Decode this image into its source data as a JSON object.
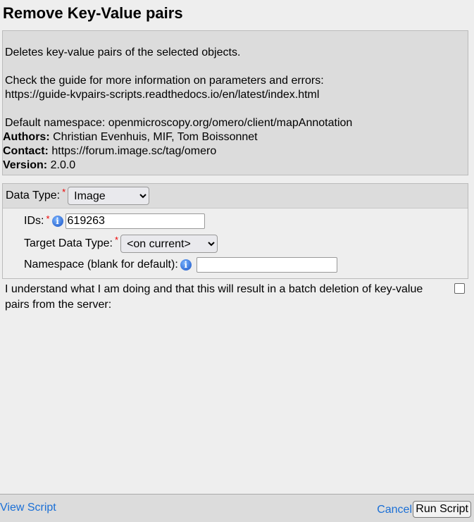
{
  "title": "Remove Key-Value pairs",
  "description": {
    "summary": "Deletes key-value pairs of the selected objects.",
    "guide_text": "Check the guide for more information on parameters and errors:",
    "guide_url": "https://guide-kvpairs-scripts.readthedocs.io/en/latest/index.html",
    "default_ns": "Default namespace: openmicroscopy.org/omero/client/mapAnnotation",
    "authors_label": "Authors:",
    "authors": "Christian Evenhuis, MIF, Tom Boissonnet",
    "contact_label": "Contact:",
    "contact": "https://forum.image.sc/tag/omero",
    "version_label": "Version:",
    "version": "2.0.0"
  },
  "params": {
    "data_type_label": "Data Type:",
    "data_type_value": "Image",
    "ids_label": "IDs:",
    "ids_value": "619263",
    "target_label": "Target Data Type:",
    "target_value": "<on current>",
    "namespace_label": "Namespace (blank for default):",
    "namespace_value": "",
    "required_mark": "*"
  },
  "confirm": {
    "label": "I understand what I am doing and that this will result in a batch deletion of key-value pairs from the server:",
    "checked": false
  },
  "footer": {
    "view_script": "View Script",
    "cancel": "Cancel",
    "run": "Run Script"
  }
}
